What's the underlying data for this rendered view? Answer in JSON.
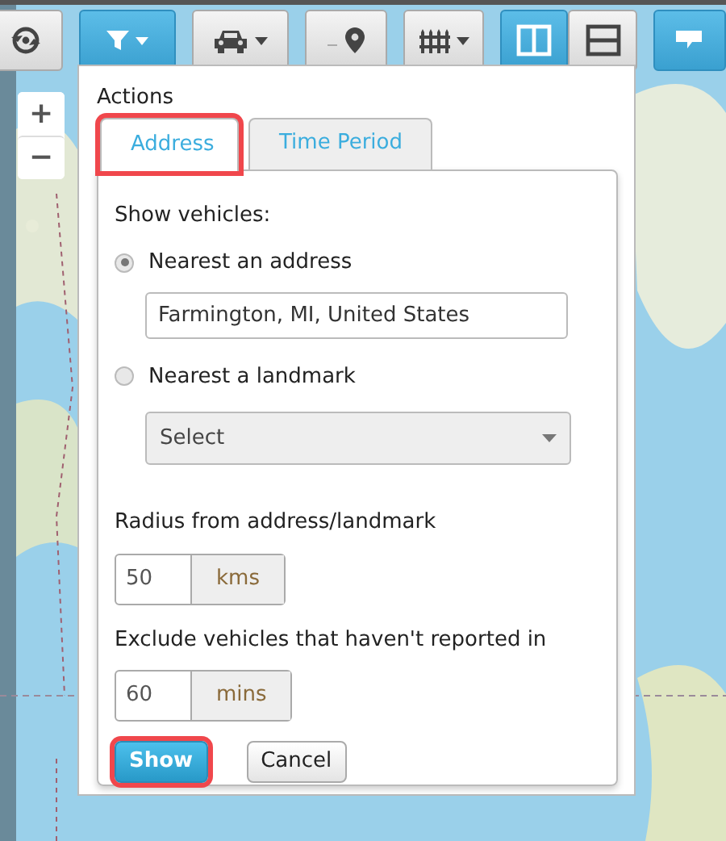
{
  "toolbar": {
    "buttons": [
      {
        "kind": "refresh",
        "selected": false,
        "caret": false
      },
      {
        "kind": "filter",
        "selected": true,
        "caret": true
      },
      {
        "kind": "car",
        "selected": false,
        "caret": true
      },
      {
        "kind": "pin",
        "selected": false,
        "caret": false
      },
      {
        "kind": "fence",
        "selected": false,
        "caret": true
      },
      {
        "kind": "split-columns",
        "selected": true,
        "caret": false
      },
      {
        "kind": "split-rows",
        "selected": false,
        "caret": false
      },
      {
        "kind": "comment",
        "selected": true,
        "caret": false
      }
    ]
  },
  "map": {
    "zoom_in": "+",
    "zoom_out": "−"
  },
  "panel": {
    "title": "Actions",
    "tabs": [
      {
        "label": "Address",
        "selected": true,
        "highlighted": true
      },
      {
        "label": "Time Period",
        "selected": false,
        "highlighted": false
      }
    ],
    "section_label": "Show vehicles:",
    "options": [
      {
        "label": "Nearest an address",
        "selected": true
      },
      {
        "label": "Nearest a landmark",
        "selected": false
      }
    ],
    "address_value": "Farmington, MI, United States",
    "landmark_select": "Select",
    "radius_label": "Radius from address/landmark",
    "radius_value": "50",
    "radius_unit": "kms",
    "exclude_label": "Exclude vehicles that haven't reported in",
    "exclude_value": "60",
    "exclude_unit": "mins",
    "buttons": [
      {
        "label": "Show",
        "kind": "primary",
        "highlighted": true
      },
      {
        "label": "Cancel",
        "kind": "secondary",
        "highlighted": false
      }
    ]
  }
}
